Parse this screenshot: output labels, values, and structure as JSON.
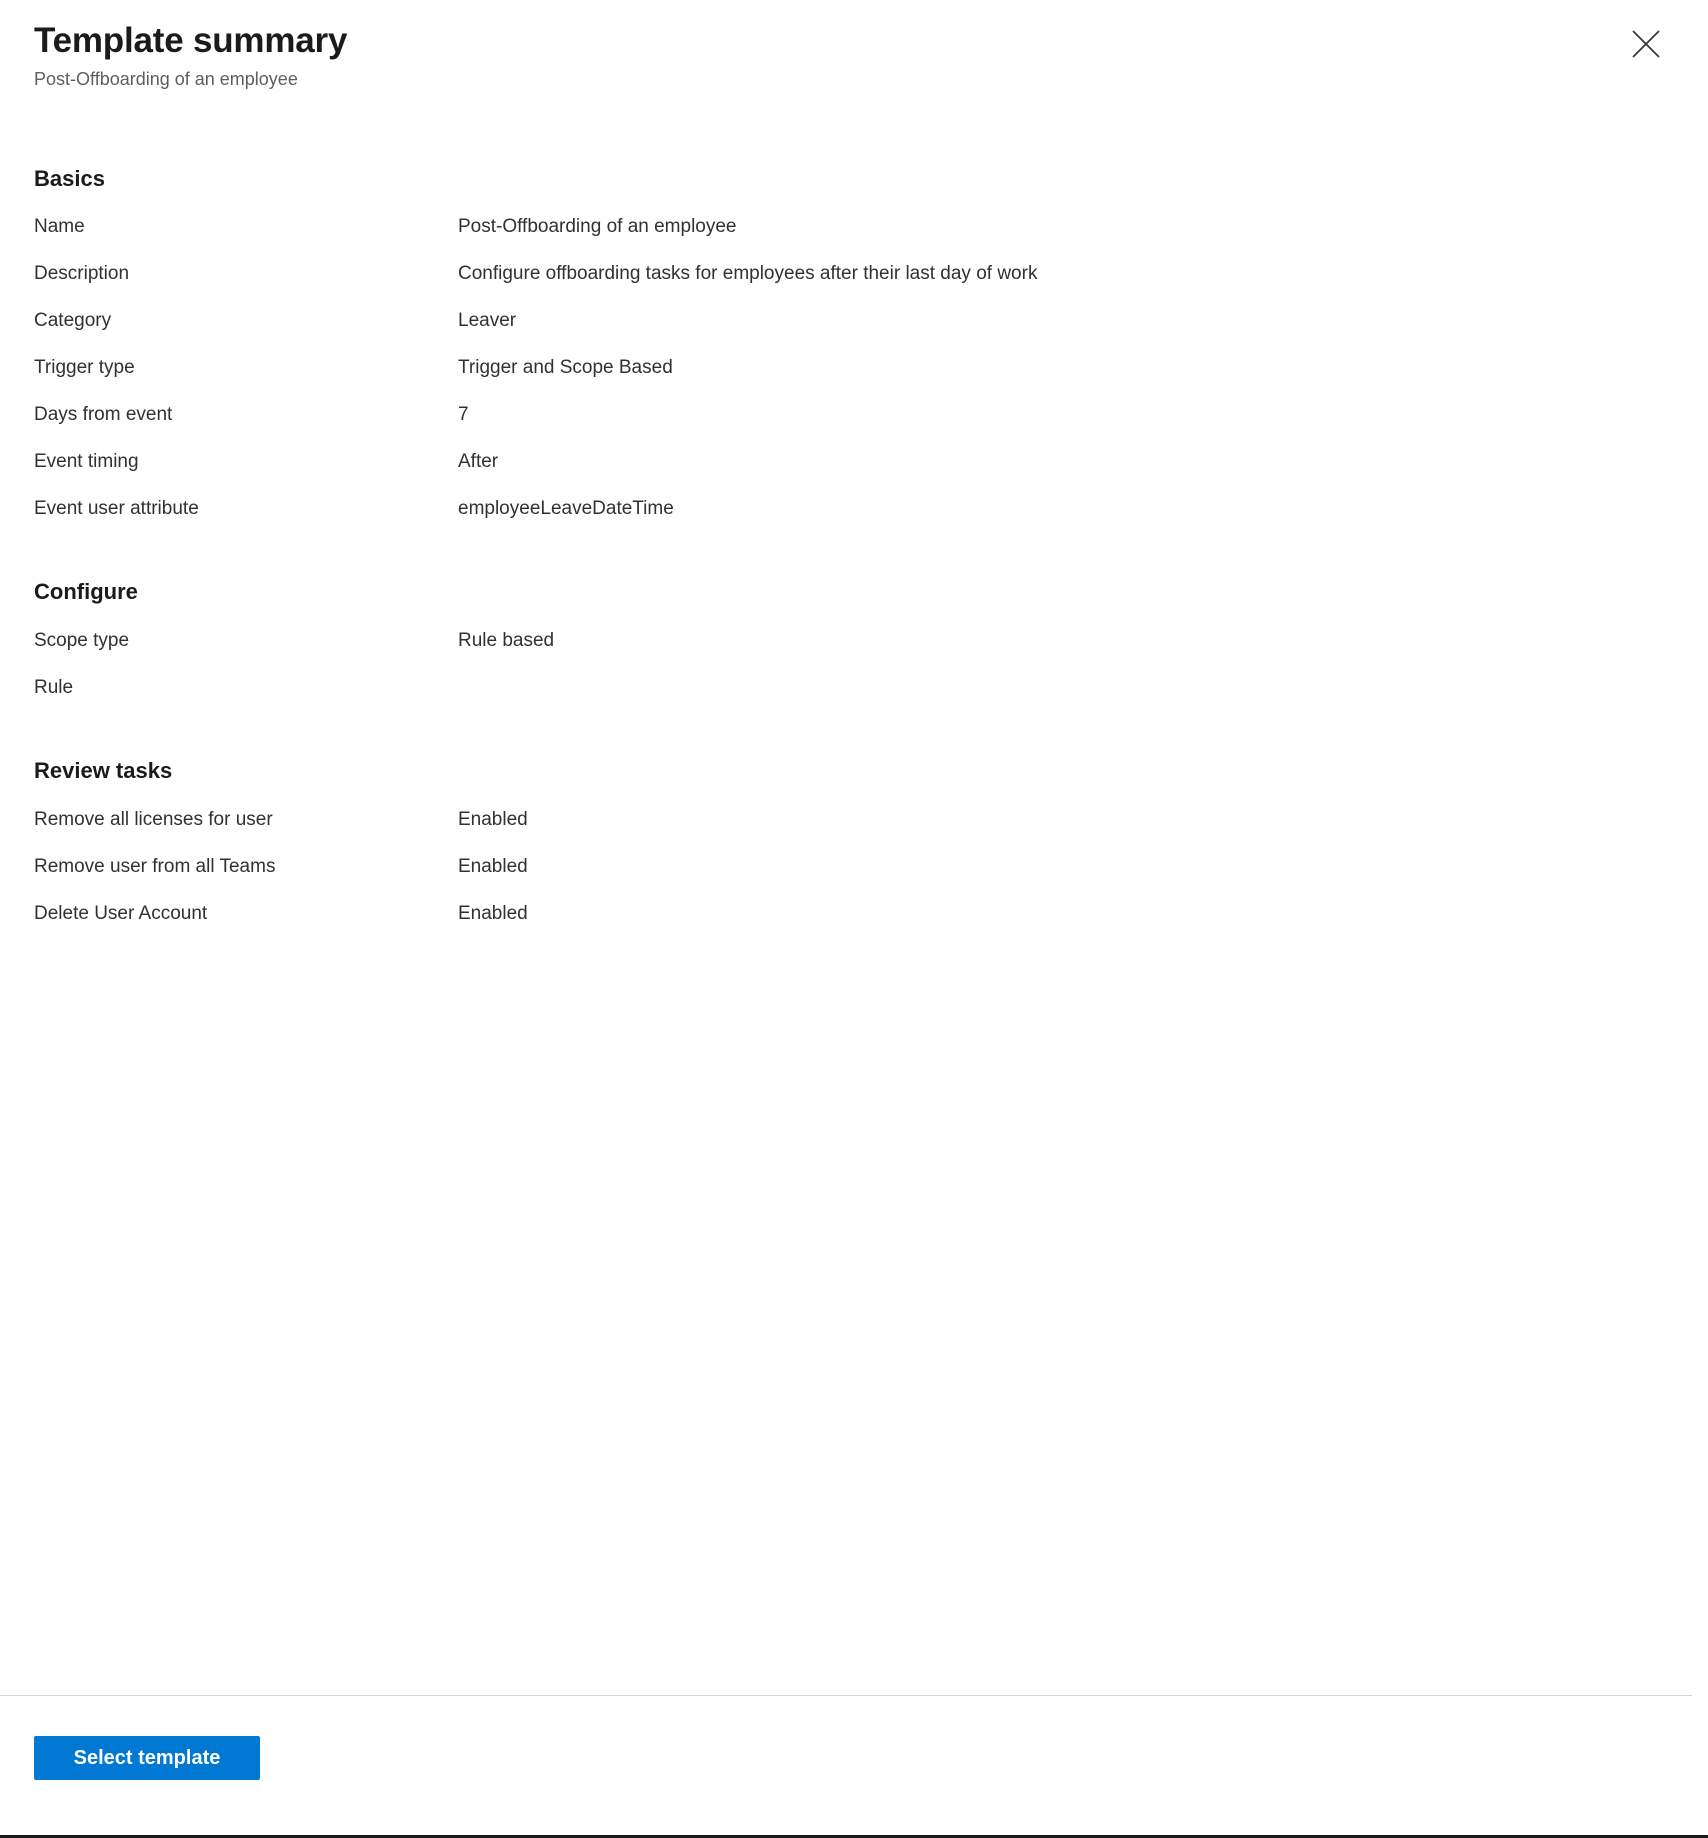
{
  "header": {
    "title": "Template summary",
    "subtitle": "Post-Offboarding of an employee",
    "close_icon": "close-icon"
  },
  "sections": [
    {
      "key": "basics",
      "heading": "Basics",
      "rows": [
        {
          "label": "Name",
          "value": "Post-Offboarding of an employee"
        },
        {
          "label": "Description",
          "value": "Configure offboarding tasks for employees after their last day of work"
        },
        {
          "label": "Category",
          "value": "Leaver"
        },
        {
          "label": "Trigger type",
          "value": "Trigger and Scope Based"
        },
        {
          "label": "Days from event",
          "value": "7"
        },
        {
          "label": "Event timing",
          "value": "After"
        },
        {
          "label": "Event user attribute",
          "value": "employeeLeaveDateTime"
        }
      ]
    },
    {
      "key": "configure",
      "heading": "Configure",
      "rows": [
        {
          "label": "Scope type",
          "value": "Rule based"
        },
        {
          "label": "Rule",
          "value": ""
        }
      ]
    },
    {
      "key": "review_tasks",
      "heading": "Review tasks",
      "rows": [
        {
          "label": "Remove all licenses for user",
          "value": "Enabled"
        },
        {
          "label": "Remove user from all Teams",
          "value": "Enabled"
        },
        {
          "label": "Delete User Account",
          "value": "Enabled"
        }
      ]
    }
  ],
  "footer": {
    "primary_button_label": "Select template"
  },
  "colors": {
    "accent": "#0078d4",
    "text": "#323130",
    "heading": "#1b1b1b",
    "subtle_text": "#605e5c",
    "divider": "#d6d6d6"
  }
}
